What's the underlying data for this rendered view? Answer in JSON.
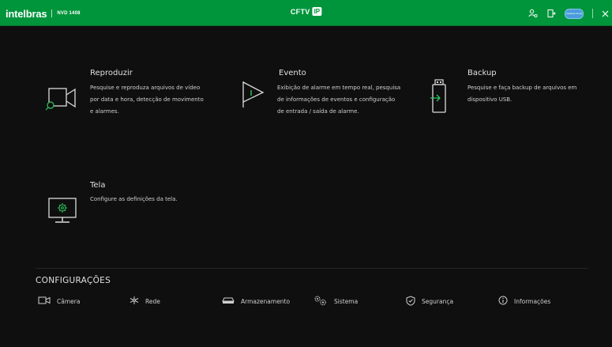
{
  "topbar": {
    "brand": "intelbras",
    "model": "NVD 1408",
    "center_text": "CFTV",
    "center_badge": "IP",
    "cloud_label": "Intelbras Cloud",
    "bg_color": "#00953b"
  },
  "cards": [
    {
      "title": "Reproduzir",
      "description": "Pesquise e reproduza arquivos de vídeo por data e hora, detecção de movimento e alarmes.",
      "icon": "playback-camera-icon"
    },
    {
      "title": "Evento",
      "description": "Exibição de alarme em tempo real, pesquisa de informações de eventos e configuração de entrada / saída de alarme.",
      "icon": "event-flag-icon"
    },
    {
      "title": "Backup",
      "description": "Pesquise e faça backup de arquivos em dispositivo USB.",
      "icon": "usb-backup-icon"
    },
    {
      "title": "Tela",
      "description": "Configure as definições da tela.",
      "icon": "monitor-gear-icon"
    }
  ],
  "config": {
    "title": "CONFIGURAÇÕES",
    "items": [
      {
        "label": "Câmera",
        "icon": "camera-icon"
      },
      {
        "label": "Rede",
        "icon": "network-icon"
      },
      {
        "label": "Armazenamento",
        "icon": "storage-icon"
      },
      {
        "label": "Sistema",
        "icon": "system-gears-icon"
      },
      {
        "label": "Segurança",
        "icon": "shield-icon"
      },
      {
        "label": "Informações",
        "icon": "info-icon"
      }
    ]
  },
  "colors": {
    "accent": "#2ec75f",
    "background": "#0f0f0f"
  }
}
